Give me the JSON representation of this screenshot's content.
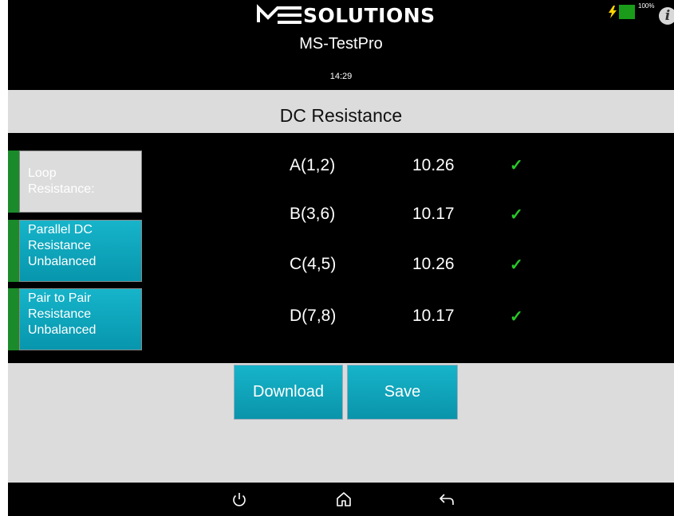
{
  "header": {
    "logo_text": "SOLUTIONS",
    "app_title": "MS-TestPro",
    "time": "14:29",
    "battery_percent": "100%",
    "info_label": "i"
  },
  "page": {
    "title": "DC Resistance"
  },
  "side_buttons": [
    {
      "label_line1": "Loop",
      "label_line2": "Resistance:",
      "label_line3": ""
    },
    {
      "label_line1": "Parallel DC",
      "label_line2": "Resistance",
      "label_line3": "Unbalanced"
    },
    {
      "label_line1": "Pair to Pair",
      "label_line2": "Resistance",
      "label_line3": "Unbalanced"
    }
  ],
  "results": [
    {
      "pair": "A(1,2)",
      "value": "10.26",
      "status": "✓"
    },
    {
      "pair": "B(3,6)",
      "value": "10.17",
      "status": "✓"
    },
    {
      "pair": "C(4,5)",
      "value": "10.26",
      "status": "✓"
    },
    {
      "pair": "D(7,8)",
      "value": "10.17",
      "status": "✓"
    }
  ],
  "actions": {
    "download_label": "Download",
    "save_label": "Save"
  },
  "colors": {
    "accent": "#0ea5bd",
    "pass": "#28c828",
    "strip": "#1b8a2a",
    "band": "#dcdcdc"
  },
  "icons": [
    "bolt-icon",
    "battery-icon",
    "info-icon",
    "check-icon",
    "power-icon",
    "home-icon",
    "back-icon"
  ]
}
